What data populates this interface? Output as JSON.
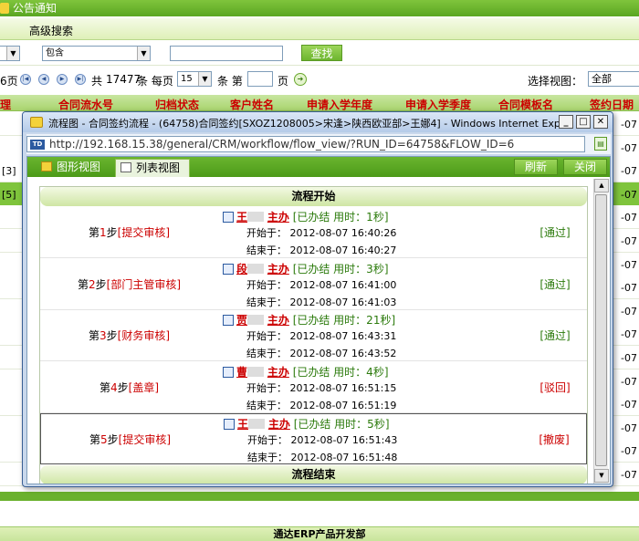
{
  "app": {
    "title": "公告通知",
    "tab_label": "高级搜索",
    "filter_select_1": "",
    "filter_select_2": "包含",
    "filter_select_page_size": "15",
    "search_button": "查找",
    "pager_prefix": "6页",
    "pager_total_label": "共",
    "pager_total": "17477",
    "pager_unit": "条 每页",
    "pager_unit2": "条 第",
    "pager_page_unit": "页",
    "view_label": "选择视图：",
    "view_select": "全部",
    "table_headers": [
      "理",
      "合同流水号",
      "归档状态",
      "客户姓名",
      "申请入学年度",
      "申请入学季度",
      "合同模板名",
      "签约日期"
    ],
    "left_cells": [
      "",
      "",
      "[3]",
      "[5]",
      "",
      "",
      "",
      "",
      "",
      "",
      "",
      "",
      "",
      "",
      "",
      ""
    ],
    "right_cells": [
      "-07",
      "-07",
      "-07",
      "-07",
      "-07",
      "-07",
      "-07",
      "-07",
      "-07",
      "-07",
      "-07",
      "-07",
      "-07",
      "-07",
      "-07",
      "-07"
    ],
    "footer": "通达ERP产品开发部"
  },
  "popup": {
    "title": "流程图 - 合同签约流程 - (64758)合同签约[SXOZ1208005>宋逢>陕西欧亚部>王娜4] - Windows Internet Explo...",
    "minimize": "_",
    "maximize": "□",
    "close": "✕",
    "address_icon": "TD",
    "url": "http://192.168.15.38/general/CRM/workflow/flow_view/?RUN_ID=64758&FLOW_ID=6",
    "tab_graph": "图形视图",
    "tab_list": "列表视图",
    "refresh_button": "刷新",
    "close_button": "关闭",
    "flow_start": "流程开始",
    "flow_end": "流程结束",
    "steps": [
      {
        "no_prefix": "第",
        "no": "1",
        "no_suffix": "步",
        "name": "[提交审核]",
        "person": "王",
        "role": "主办",
        "status": "[已办结 用时：1秒]",
        "start": "开始于：  2012-08-07  16:40:26",
        "end": "结束于：  2012-08-07  16:40:27",
        "result": "[通过]",
        "result_ok": true
      },
      {
        "no_prefix": "第",
        "no": "2",
        "no_suffix": "步",
        "name": "[部门主管审核]",
        "person": "段",
        "role": "主办",
        "status": "[已办结 用时：3秒]",
        "start": "开始于：  2012-08-07  16:41:00",
        "end": "结束于：  2012-08-07  16:41:03",
        "result": "[通过]",
        "result_ok": true
      },
      {
        "no_prefix": "第",
        "no": "3",
        "no_suffix": "步",
        "name": "[财务审核]",
        "person": "贾",
        "role": "主办",
        "status": "[已办结 用时：21秒]",
        "start": "开始于：  2012-08-07  16:43:31",
        "end": "结束于：  2012-08-07  16:43:52",
        "result": "[通过]",
        "result_ok": true
      },
      {
        "no_prefix": "第",
        "no": "4",
        "no_suffix": "步",
        "name": "[盖章]",
        "person": "曹",
        "role": "主办",
        "status": "[已办结 用时：4秒]",
        "start": "开始于：  2012-08-07  16:51:15",
        "end": "结束于：  2012-08-07  16:51:19",
        "result": "[驳回]",
        "result_ok": false
      },
      {
        "no_prefix": "第",
        "no": "5",
        "no_suffix": "步",
        "name": "[提交审核]",
        "person": "王",
        "role": "主办",
        "status": "[已办结 用时：5秒]",
        "start": "开始于：  2012-08-07  16:51:43",
        "end": "结束于：  2012-08-07  16:51:48",
        "result": "[撤废]",
        "result_ok": false
      }
    ]
  },
  "colors": {
    "accent_green": "#6ab12d",
    "step_red": "#cc0000",
    "status_green": "#2b7a0b"
  }
}
